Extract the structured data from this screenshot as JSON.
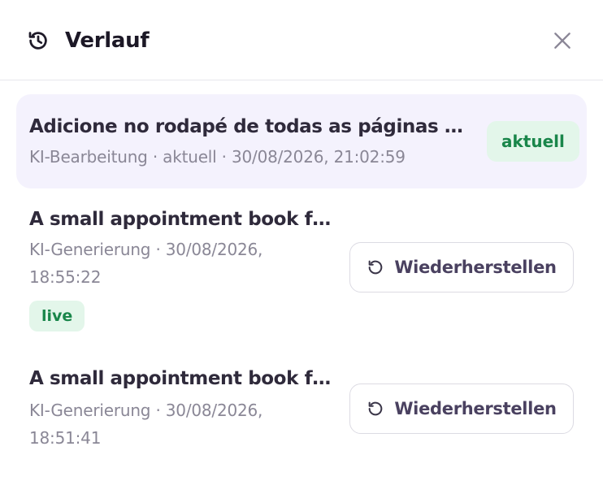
{
  "header": {
    "title": "Verlauf",
    "icon": "history-icon",
    "close_icon": "close-icon"
  },
  "entries": [
    {
      "title": "Adicione no rodapé de todas as páginas a linha",
      "meta": "KI-Bearbeitung · aktuell · 30/08/2026, 21:02:59",
      "badge": "aktuell",
      "is_current": true
    },
    {
      "title": "A small appointment book for a barbershop",
      "meta_line1": "KI-Generierung · 30/08/2026,",
      "meta_line2": "18:55:22",
      "badge": "live",
      "action_label": "Wiederherstellen"
    },
    {
      "title": "A small appointment book for a barbershop",
      "meta_line1": "KI-Generierung · 30/08/2026,",
      "meta_line2": "18:51:41",
      "action_label": "Wiederherstellen"
    }
  ],
  "colors": {
    "current_bg": "#f4f2fd",
    "badge_bg": "#e3f6ea",
    "badge_text": "#19864a",
    "meta_text": "#8a8796",
    "title_text": "#2f2a3b",
    "button_text": "#4a4160"
  }
}
